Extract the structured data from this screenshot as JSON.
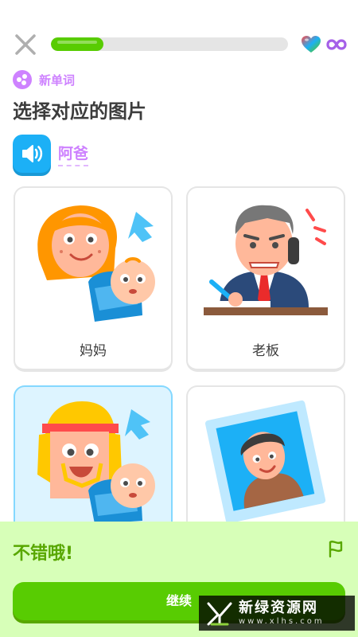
{
  "progress": {
    "fraction": 0.22
  },
  "header": {
    "close_icon": "close-icon",
    "hearts_icon": "gem-heart-icon",
    "infinity_icon": "infinity-icon"
  },
  "tag": {
    "icon": "sparkle-icon",
    "label": "新单词"
  },
  "prompt": {
    "title": "选择对应的图片"
  },
  "audio": {
    "icon": "speaker-icon",
    "word": "阿爸"
  },
  "options": [
    {
      "label": "妈妈",
      "selected": false
    },
    {
      "label": "老板",
      "selected": false
    },
    {
      "label": "",
      "selected": true
    },
    {
      "label": "",
      "selected": false
    }
  ],
  "footer": {
    "feedback": "不错哦!",
    "flag_icon": "report-flag-icon",
    "continue_label": "继续"
  },
  "watermark": {
    "title": "新绿资源网",
    "url": "www.xlhs.com"
  },
  "colors": {
    "green": "#58cc02",
    "green_dark": "#58a700",
    "blue": "#1cb0f6",
    "purple": "#ce82ff",
    "feedback_bg": "#d7ffb8",
    "selected_bg": "#ddf4ff"
  }
}
